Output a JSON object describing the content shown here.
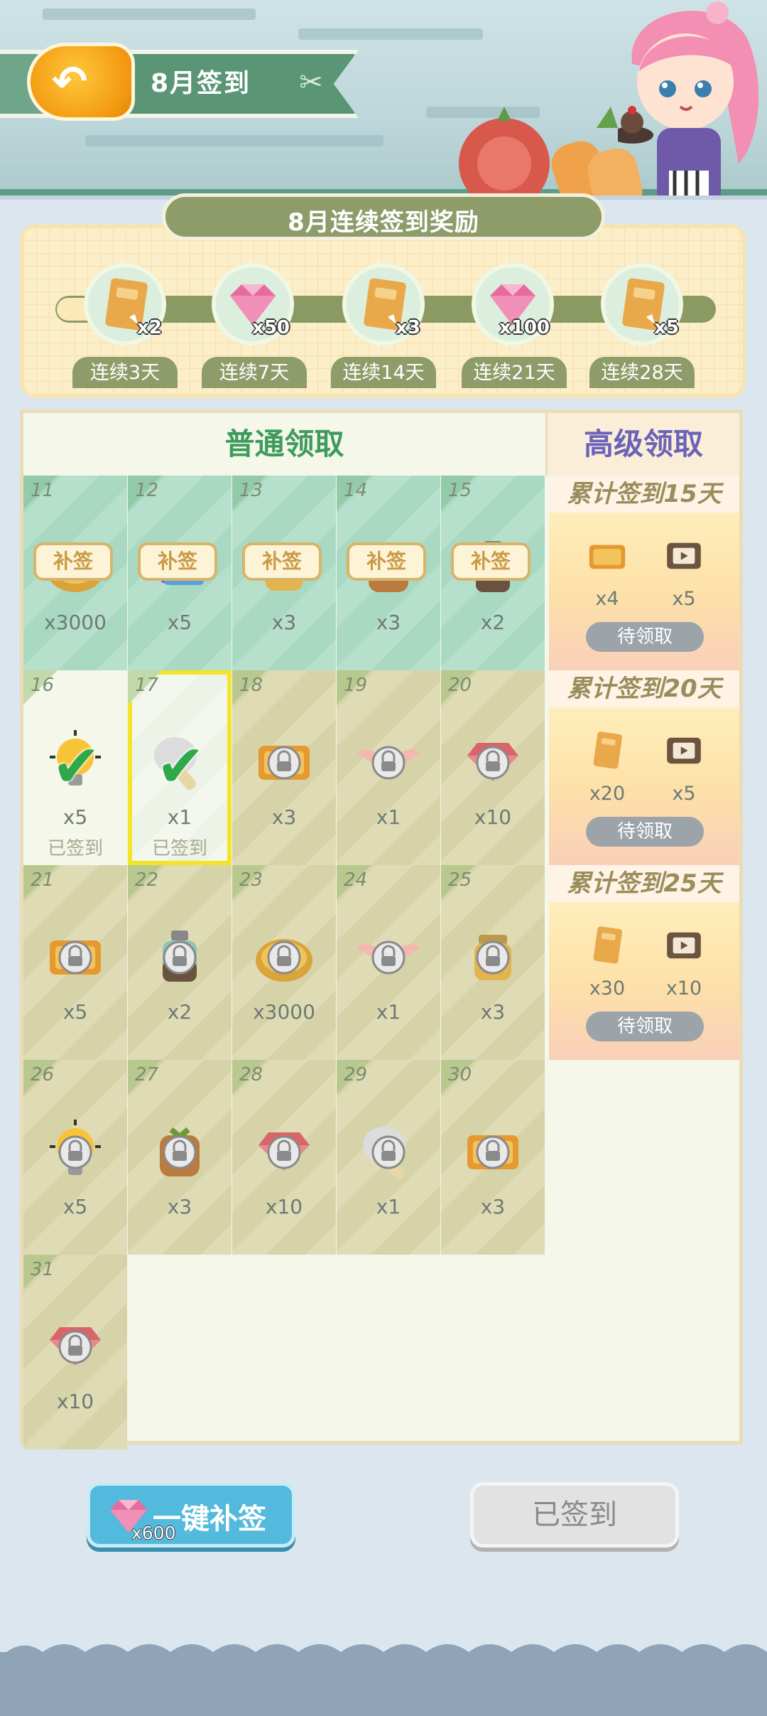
{
  "header": {
    "title": "8月签到",
    "back_icon": "back-arrow-icon",
    "utensil_icon": "utensils-icon"
  },
  "streak": {
    "title": "8月连续签到奖励",
    "rewards": [
      {
        "label": "连续3天",
        "qty": "x2",
        "icon": "recipe-book-icon"
      },
      {
        "label": "连续7天",
        "qty": "x50",
        "icon": "pink-gem-icon"
      },
      {
        "label": "连续14天",
        "qty": "x3",
        "icon": "recipe-book-icon"
      },
      {
        "label": "连续21天",
        "qty": "x100",
        "icon": "pink-gem-icon"
      },
      {
        "label": "连续28天",
        "qty": "x5",
        "icon": "recipe-book-icon"
      }
    ]
  },
  "grid": {
    "basic_header": "普通领取",
    "premium_header": "高级领取",
    "buqian_label": "补签",
    "signed_label": "已签到",
    "days": [
      {
        "day": "11",
        "qty": "x3000",
        "state": "missed",
        "icon": "coin-bag-icon"
      },
      {
        "day": "12",
        "qty": "x5",
        "state": "missed",
        "icon": "cards-icon"
      },
      {
        "day": "13",
        "qty": "x3",
        "state": "missed",
        "icon": "jar-icon"
      },
      {
        "day": "14",
        "qty": "x3",
        "state": "missed",
        "icon": "sack-icon"
      },
      {
        "day": "15",
        "qty": "x2",
        "state": "missed",
        "icon": "bottle-icon"
      },
      {
        "day": "16",
        "qty": "x5",
        "state": "signed",
        "icon": "lightbulb-icon"
      },
      {
        "day": "17",
        "qty": "x1",
        "state": "signed-today",
        "icon": "mushroom-icon"
      },
      {
        "day": "18",
        "qty": "x3",
        "state": "locked",
        "icon": "ticket-lock-icon"
      },
      {
        "day": "19",
        "qty": "x1",
        "state": "locked",
        "icon": "wings-lock-icon"
      },
      {
        "day": "20",
        "qty": "x10",
        "state": "locked",
        "icon": "gem-lock-icon"
      },
      {
        "day": "21",
        "qty": "x5",
        "state": "locked",
        "icon": "ticket-lock-icon"
      },
      {
        "day": "22",
        "qty": "x2",
        "state": "locked",
        "icon": "bottle-lock-icon"
      },
      {
        "day": "23",
        "qty": "x3000",
        "state": "locked",
        "icon": "coin-lock-icon"
      },
      {
        "day": "24",
        "qty": "x1",
        "state": "locked",
        "icon": "wings-lock-icon"
      },
      {
        "day": "25",
        "qty": "x3",
        "state": "locked",
        "icon": "jar-lock-icon"
      },
      {
        "day": "26",
        "qty": "x5",
        "state": "locked",
        "icon": "lightbulb-lock-icon"
      },
      {
        "day": "27",
        "qty": "x3",
        "state": "locked",
        "icon": "sack-lock-icon"
      },
      {
        "day": "28",
        "qty": "x10",
        "state": "locked",
        "icon": "gem-lock-icon"
      },
      {
        "day": "29",
        "qty": "x1",
        "state": "locked",
        "icon": "mushroom-lock-icon"
      },
      {
        "day": "30",
        "qty": "x3",
        "state": "locked",
        "icon": "ticket-lock-icon"
      },
      {
        "day": "31",
        "qty": "x10",
        "state": "locked",
        "icon": "gem-lock-icon"
      }
    ],
    "tiers": [
      {
        "title": "累计签到15天",
        "items": [
          {
            "qty": "x4",
            "icon": "ticket-icon"
          },
          {
            "qty": "x5",
            "icon": "film-icon"
          }
        ],
        "button": "待领取"
      },
      {
        "title": "累计签到20天",
        "items": [
          {
            "qty": "x20",
            "icon": "recipe-book-icon"
          },
          {
            "qty": "x5",
            "icon": "film-icon"
          }
        ],
        "button": "待领取"
      },
      {
        "title": "累计签到25天",
        "items": [
          {
            "qty": "x30",
            "icon": "recipe-book-icon"
          },
          {
            "qty": "x10",
            "icon": "film-icon"
          }
        ],
        "button": "待领取"
      }
    ]
  },
  "actions": {
    "buqian_all": {
      "label": "一键补签",
      "cost": "x600",
      "icon": "pink-gem-icon"
    },
    "signed": {
      "label": "已签到"
    }
  },
  "colors": {
    "green_cell": "#a9d9c2",
    "olive_cell": "#d6d3a9",
    "check": "#2fa84a",
    "highlight": "#f1e42a",
    "premium_text": "#6a63b8",
    "basic_text": "#3f9b5c"
  }
}
